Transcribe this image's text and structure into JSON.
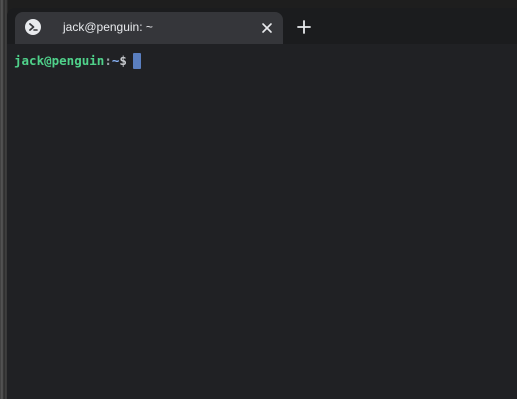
{
  "tab": {
    "title": "jack@penguin: ~",
    "icon": "terminal-icon",
    "close_icon": "close-icon"
  },
  "new_tab_icon": "plus-icon",
  "terminal": {
    "user_host": "jack@penguin",
    "separator": ":",
    "path": "~",
    "prompt_symbol": "$"
  },
  "colors": {
    "background": "#202124",
    "tab_active": "#35363a",
    "user_host": "#4fd18a",
    "cursor": "#5a7fc0"
  }
}
